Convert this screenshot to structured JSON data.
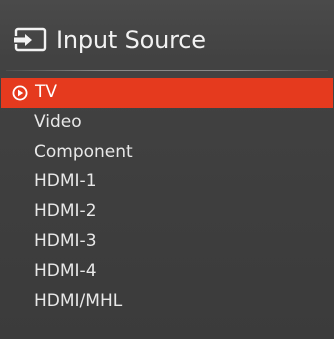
{
  "header": {
    "title": "Input Source",
    "icon": "input-source-icon"
  },
  "sources": [
    {
      "label": "TV",
      "selected": true
    },
    {
      "label": "Video",
      "selected": false
    },
    {
      "label": "Component",
      "selected": false
    },
    {
      "label": "HDMI-1",
      "selected": false
    },
    {
      "label": "HDMI-2",
      "selected": false
    },
    {
      "label": "HDMI-3",
      "selected": false
    },
    {
      "label": "HDMI-4",
      "selected": false
    },
    {
      "label": "HDMI/MHL",
      "selected": false
    }
  ],
  "colors": {
    "selected_background": "#e53a1e",
    "panel_background": "#3e3e3e",
    "text": "#e8e8e8"
  },
  "selected_icon": "radio-selected-icon"
}
